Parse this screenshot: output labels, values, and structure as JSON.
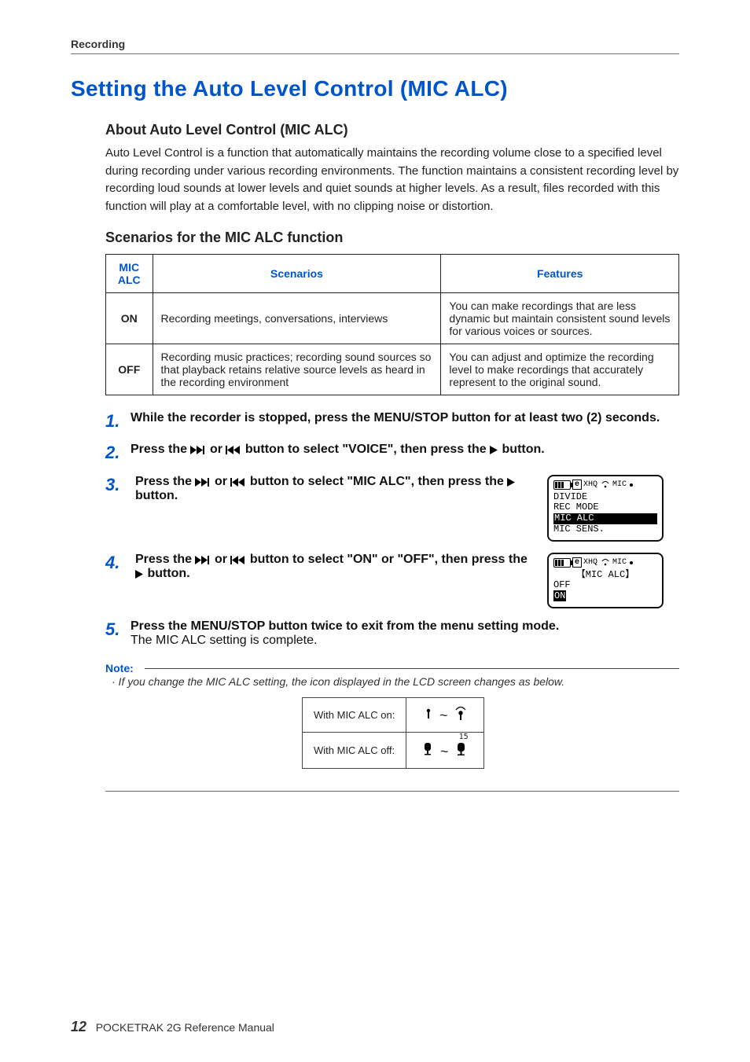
{
  "header": {
    "section": "Recording"
  },
  "title": "Setting the Auto Level Control (MIC ALC)",
  "about": {
    "heading": "About Auto Level Control (MIC ALC)",
    "text": "Auto Level Control is a function that automatically maintains the recording volume close to a specified level during recording under various recording environments. The function maintains a consistent recording level by recording loud sounds at lower levels and quiet sounds at higher levels. As a result, files recorded with this function will play at a comfortable level, with no clipping noise or distortion."
  },
  "scenarios": {
    "heading": "Scenarios for the MIC ALC function",
    "columns": {
      "c1": "MIC ALC",
      "c2": "Scenarios",
      "c3": "Features"
    },
    "rows": [
      {
        "mode": "ON",
        "scenario": "Recording meetings, conversations, interviews",
        "feature": "You can make recordings that are less dynamic but maintain consistent sound levels for various voices or sources."
      },
      {
        "mode": "OFF",
        "scenario": "Recording music practices; recording sound sources so that playback retains relative source levels as heard in the recording environment",
        "feature": "You can adjust and optimize the recording level to make recordings that accurately represent to the original sound."
      }
    ]
  },
  "steps": {
    "s1": "While the recorder is stopped, press the MENU/STOP button for at least two (2) seconds.",
    "s2a": "Press the ",
    "s2b": " or ",
    "s2c": " button to select \"VOICE\", then press the ",
    "s2d": " button.",
    "s3a": "Press the ",
    "s3b": " or ",
    "s3c": " button to select \"MIC ALC\", then press the ",
    "s3d": " button.",
    "s4a": "Press the ",
    "s4b": " or ",
    "s4c": " button to select \"ON\" or \"OFF\", then press the ",
    "s4d": " button.",
    "s5a": "Press the MENU/STOP button twice to exit from the menu setting mode.",
    "s5b": "The MIC ALC setting is complete."
  },
  "lcd1": {
    "xhq": "XHQ",
    "mic": "MIC",
    "l1": "DIVIDE",
    "l2": "REC MODE",
    "l3": "MIC ALC",
    "l4": "MIC SENS."
  },
  "lcd2": {
    "xhq": "XHQ",
    "mic": "MIC",
    "title": "【MIC ALC】",
    "l1": "OFF",
    "l2": "ON"
  },
  "note": {
    "label": "Note:",
    "text": "· If you change the MIC ALC setting, the icon displayed in the LCD screen changes as below.",
    "row1": "With MIC ALC on:",
    "row2": "With MIC ALC off:",
    "fifteen": "15"
  },
  "footer": {
    "pagenum": "12",
    "doc": "POCKETRAK 2G   Reference Manual"
  },
  "icons": {
    "e": "e"
  }
}
